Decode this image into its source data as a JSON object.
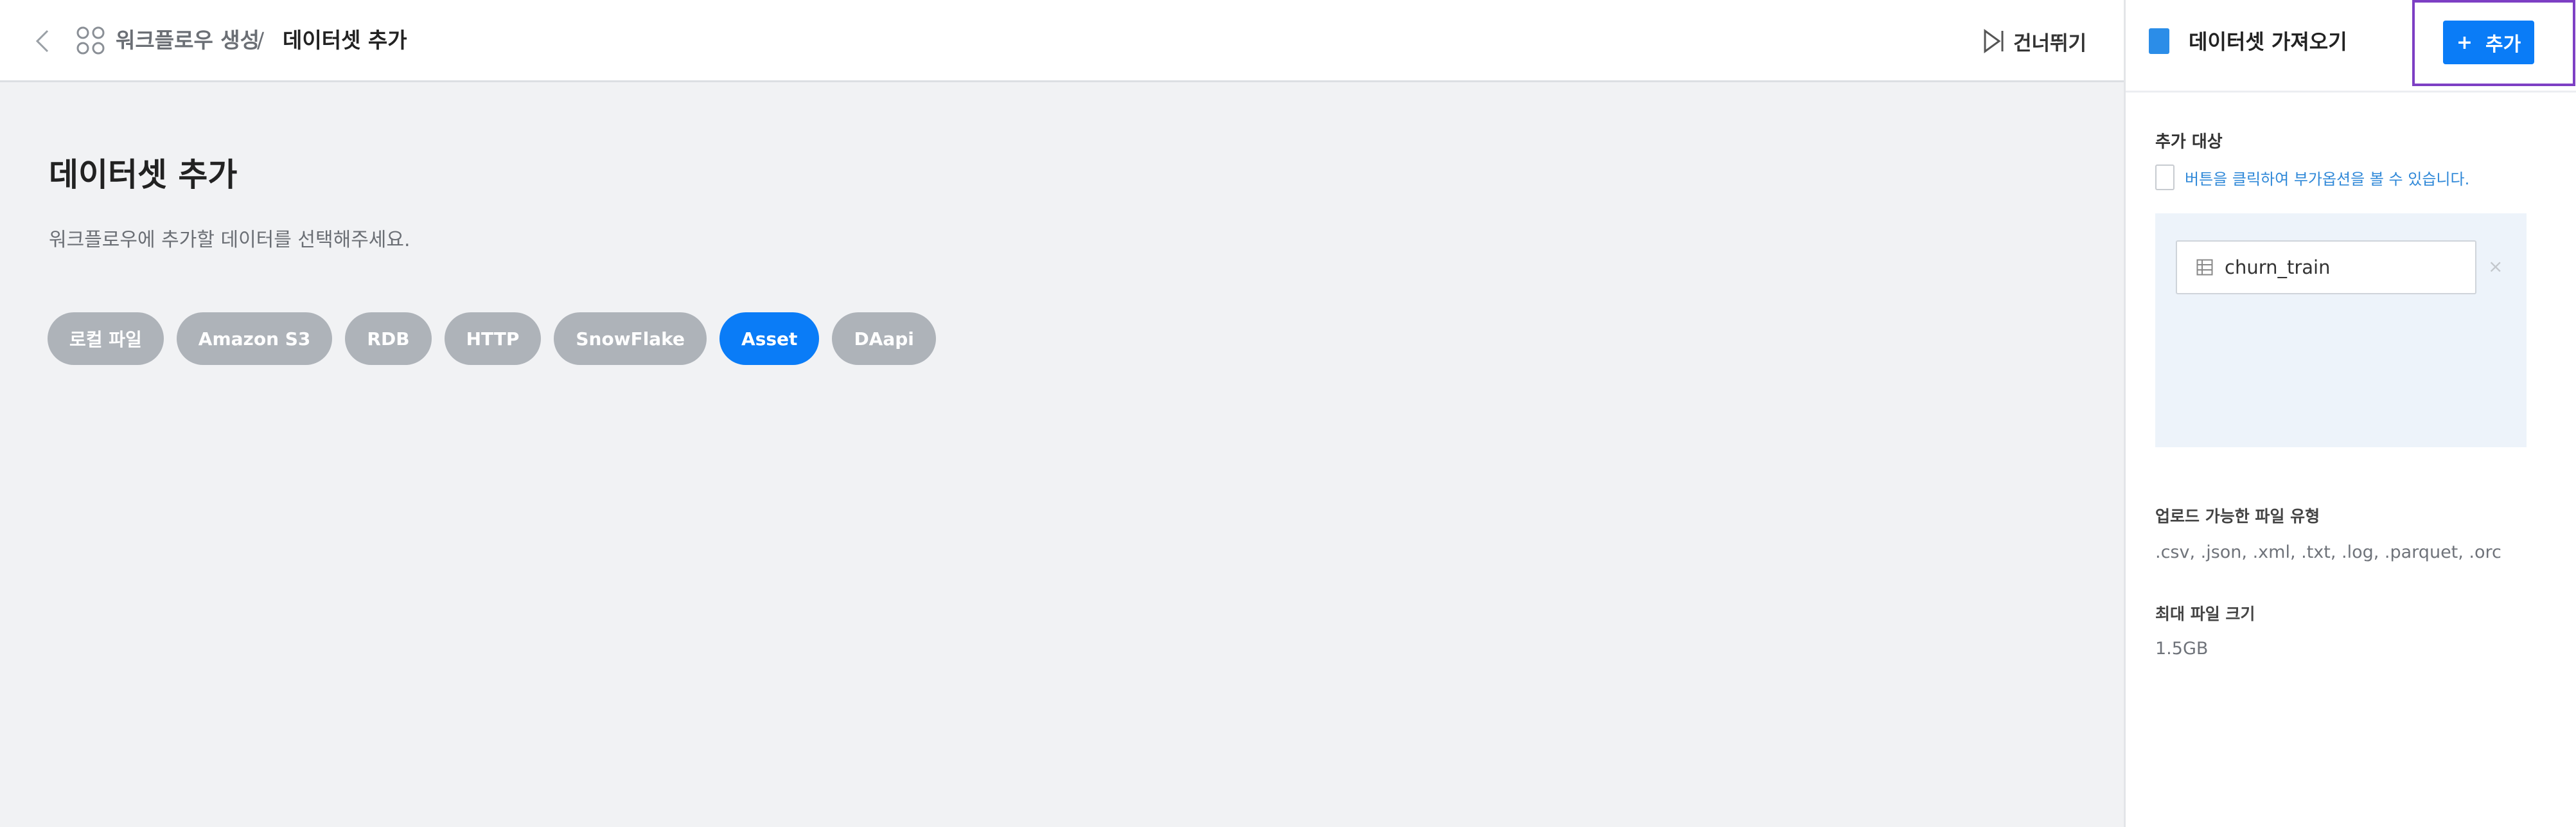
{
  "header": {
    "breadcrumb_parent": "워크플로우 생성",
    "breadcrumb_separator": "/",
    "breadcrumb_current": "데이터셋 추가",
    "skip_label": "건너뛰기"
  },
  "main": {
    "title": "데이터셋 추가",
    "description": "워크플로우에 추가할 데이터를 선택해주세요.",
    "sources": [
      {
        "label": "로컬 파일",
        "active": false
      },
      {
        "label": "Amazon S3",
        "active": false
      },
      {
        "label": "RDB",
        "active": false
      },
      {
        "label": "HTTP",
        "active": false
      },
      {
        "label": "SnowFlake",
        "active": false
      },
      {
        "label": "Asset",
        "active": true
      },
      {
        "label": "DAapi",
        "active": false
      }
    ]
  },
  "panel": {
    "title": "데이터셋 가져오기",
    "add_button_icon": "+",
    "add_button_label": "추가",
    "target_label": "추가 대상",
    "hint": "버튼을 클릭하여 부가옵션을 볼 수 있습니다.",
    "target_items": [
      {
        "name": "churn_train",
        "icon": "table-icon"
      }
    ],
    "remove_symbol": "×",
    "file_types_label": "업로드 가능한 파일 유형",
    "file_types_value": ".csv, .json, .xml, .txt, .log, .parquet, .orc",
    "max_size_label": "최대 파일 크기",
    "max_size_value": "1.5GB"
  },
  "colors": {
    "accent": "#0a7cf7",
    "chip_inactive": "#aeb3b9",
    "highlight_border": "#7d3fc4",
    "background": "#f1f2f4"
  }
}
